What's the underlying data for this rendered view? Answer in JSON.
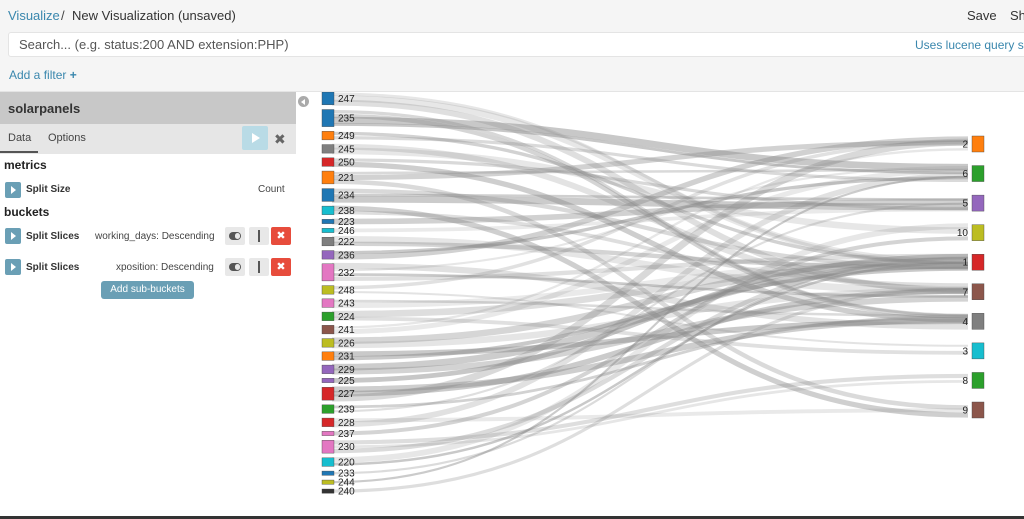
{
  "header": {
    "breadcrumb_root": "Visualize",
    "separator": "/",
    "title": "New Visualization (unsaved)",
    "save": "Save",
    "share": "Sh"
  },
  "query": {
    "placeholder": "Search... (e.g. status:200 AND extension:PHP)",
    "syntax_link": "Uses lucene query s"
  },
  "filter": {
    "add_label": "Add a filter",
    "add_icon": "+"
  },
  "sidebar": {
    "index_name": "solarpanels",
    "tabs": [
      "Data",
      "Options"
    ],
    "active_tab": "Data",
    "apply_icon": "play-icon",
    "discard_icon": "✖",
    "metrics_title": "metrics",
    "metric": {
      "label": "Split Size",
      "value": "Count"
    },
    "buckets_title": "buckets",
    "buckets": [
      {
        "label": "Split Slices",
        "desc": "working_days: Descending"
      },
      {
        "label": "Split Slices",
        "desc": "xposition: Descending"
      }
    ],
    "remove_icon": "✖",
    "add_sub_buckets": "Add sub-buckets"
  },
  "colors": {
    "accent": "#3a87ad",
    "button": "#6a9fb5",
    "danger": "#e74c3c",
    "link_stroke": "#888888"
  },
  "chart_data": {
    "type": "sankey",
    "sources": [
      "247",
      "235",
      "249",
      "245",
      "250",
      "221",
      "234",
      "238",
      "223",
      "246",
      "222",
      "236",
      "232",
      "248",
      "243",
      "224",
      "241",
      "226",
      "231",
      "229",
      "225",
      "227",
      "239",
      "228",
      "237",
      "230",
      "220",
      "233",
      "244",
      "240"
    ],
    "source_colors": [
      "#1f77b4",
      "#1f77b4",
      "#ff7f0e",
      "#7f7f7f",
      "#d62728",
      "#ff7f0e",
      "#1f77b4",
      "#17becf",
      "#1f77b4",
      "#17becf",
      "#7f7f7f",
      "#9467bd",
      "#e377c2",
      "#bcbd22",
      "#e377c2",
      "#2ca02c",
      "#8c564b",
      "#bcbd22",
      "#ff7f0e",
      "#9467bd",
      "#9467bd",
      "#d62728",
      "#2ca02c",
      "#d62728",
      "#e377c2",
      "#e377c2",
      "#17becf",
      "#1f77b4",
      "#bcbd22",
      "#333333"
    ],
    "source_sizes": [
      3,
      4,
      2,
      2,
      2,
      3,
      3,
      2,
      1,
      1,
      2,
      2,
      4,
      2,
      2,
      2,
      2,
      2,
      2,
      2,
      1,
      3,
      2,
      2,
      1,
      3,
      2,
      1,
      1,
      1
    ],
    "targets": [
      "2",
      "6",
      "5",
      "10",
      "1",
      "7",
      "4",
      "3",
      "8",
      "9"
    ],
    "target_colors": [
      "#ff7f0e",
      "#2ca02c",
      "#9467bd",
      "#bcbd22",
      "#d62728",
      "#8c564b",
      "#7f7f7f",
      "#17becf",
      "#2ca02c",
      "#8c564b"
    ]
  }
}
